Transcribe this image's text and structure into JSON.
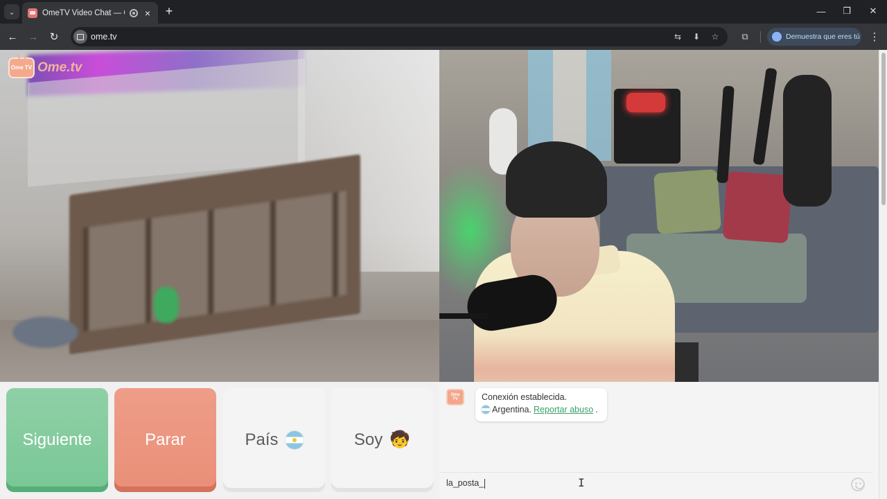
{
  "browser": {
    "tab": {
      "title": "OmeTV Video Chat — Ome",
      "close_icon": "×"
    },
    "tab_list_icon": "⌄",
    "new_tab_icon": "+",
    "window_controls": {
      "minimize": "—",
      "maximize": "❐",
      "close": "✕"
    },
    "nav": {
      "back": "←",
      "forward": "→",
      "reload": "↻"
    },
    "url": "ome.tv",
    "omnibox_icons": {
      "translate": "⇆",
      "install": "⬇",
      "bookmark": "☆"
    },
    "extensions_icon": "⧉",
    "profile_label": "Demuestra que eres tú",
    "menu_icon": "⋮"
  },
  "page": {
    "logo": {
      "tv_text": "Ome TV",
      "word": "Ome.tv"
    },
    "controls": {
      "next_label": "Siguiente",
      "stop_label": "Parar",
      "country_label": "País",
      "gender_label": "Soy",
      "gender_emoji": "🧒"
    },
    "chat": {
      "avatar_text": "Ome TV",
      "message_line1": "Conexión establecida.",
      "country_name": "Argentina.",
      "report_link": "Reportar abuso",
      "report_suffix": ".",
      "input_value": "la_posta_",
      "text_cursor": "I"
    }
  }
}
